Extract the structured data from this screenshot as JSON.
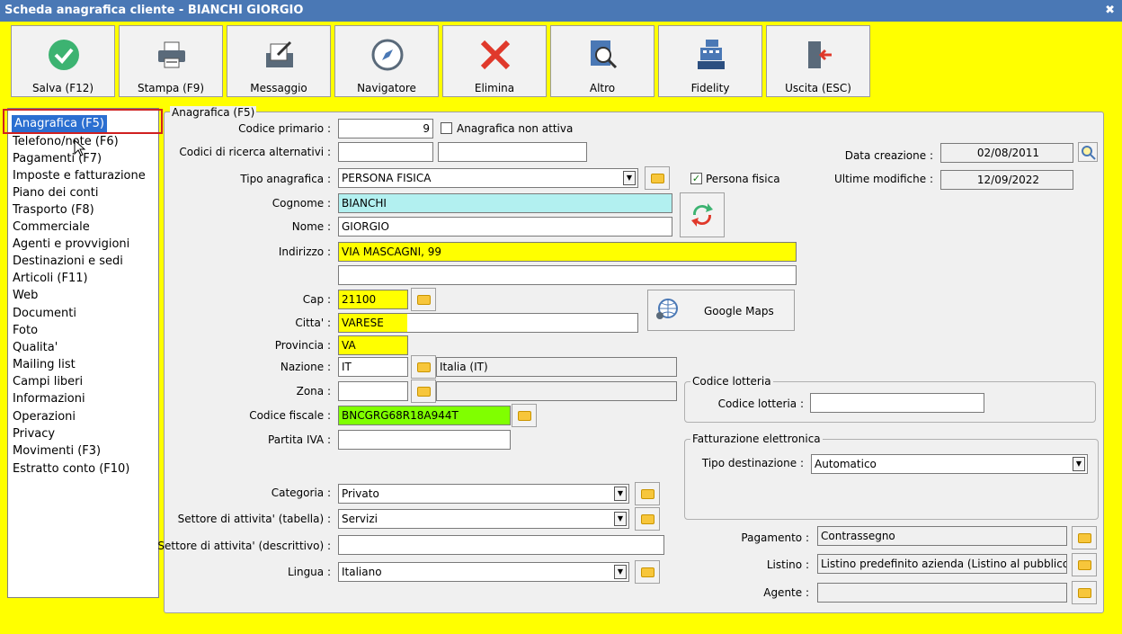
{
  "window": {
    "title": "Scheda anagrafica cliente - BIANCHI GIORGIO",
    "close_glyph": "✖"
  },
  "toolbar": [
    {
      "label": "Salva (F12)",
      "icon": "check-circle-icon"
    },
    {
      "label": "Stampa (F9)",
      "icon": "printer-icon"
    },
    {
      "label": "Messaggio",
      "icon": "message-icon"
    },
    {
      "label": "Navigatore",
      "icon": "compass-icon"
    },
    {
      "label": "Elimina",
      "icon": "delete-x-icon"
    },
    {
      "label": "Altro",
      "icon": "search-document-icon"
    },
    {
      "label": "Fidelity",
      "icon": "cash-register-icon"
    },
    {
      "label": "Uscita (ESC)",
      "icon": "exit-door-icon"
    }
  ],
  "sidebar": {
    "items": [
      {
        "label": "Anagrafica (F5)"
      },
      {
        "label": "Telefono/note (F6)"
      },
      {
        "label": "Pagamenti (F7)"
      },
      {
        "label": "Imposte e fatturazione"
      },
      {
        "label": "Piano dei conti"
      },
      {
        "label": "Trasporto (F8)"
      },
      {
        "label": "Commerciale"
      },
      {
        "label": "Agenti e provvigioni"
      },
      {
        "label": "Destinazioni e sedi"
      },
      {
        "label": "Articoli (F11)"
      },
      {
        "label": "Web"
      },
      {
        "label": "Documenti"
      },
      {
        "label": "Foto"
      },
      {
        "label": "Qualita'"
      },
      {
        "label": "Mailing list"
      },
      {
        "label": "Campi liberi"
      },
      {
        "label": "Informazioni"
      },
      {
        "label": "Operazioni"
      },
      {
        "label": "Privacy"
      },
      {
        "label": "Movimenti (F3)"
      },
      {
        "label": "Estratto conto (F10)"
      }
    ]
  },
  "form": {
    "group_title": "Anagrafica (F5)",
    "codice_primario": {
      "label": "Codice primario :",
      "value": "9"
    },
    "non_attiva": {
      "label": "Anagrafica non attiva",
      "checked": false
    },
    "codici_ricerca": {
      "label": "Codici di ricerca alternativi :",
      "value1": "",
      "value2": ""
    },
    "data_creazione": {
      "label": "Data creazione :",
      "value": "02/08/2011"
    },
    "ultime_modifiche": {
      "label": "Ultime modifiche :",
      "value": "12/09/2022"
    },
    "tipo_anagrafica": {
      "label": "Tipo anagrafica :",
      "value": "PERSONA FISICA"
    },
    "persona_fisica": {
      "label": "Persona fisica",
      "checked": true,
      "mark": "✓"
    },
    "cognome": {
      "label": "Cognome :",
      "value": "BIANCHI"
    },
    "nome": {
      "label": "Nome :",
      "value": "GIORGIO"
    },
    "indirizzo": {
      "label": "Indirizzo :",
      "value": "VIA MASCAGNI, 99",
      "value2": ""
    },
    "cap": {
      "label": "Cap :",
      "value": "21100"
    },
    "citta": {
      "label": "Citta' :",
      "value": "VARESE"
    },
    "provincia": {
      "label": "Provincia :",
      "value": "VA"
    },
    "nazione": {
      "label": "Nazione :",
      "value": "IT",
      "description": "Italia (IT)"
    },
    "zona": {
      "label": "Zona :",
      "value": "",
      "description": ""
    },
    "codice_fiscale": {
      "label": "Codice fiscale :",
      "value": "BNCGRG68R18A944T"
    },
    "partita_iva": {
      "label": "Partita IVA :",
      "value": ""
    },
    "google_maps": {
      "label": "Google Maps"
    },
    "lotteria": {
      "group_title": "Codice lotteria",
      "label": "Codice lotteria :",
      "value": ""
    },
    "fattura": {
      "group_title": "Fatturazione elettronica",
      "label": "Tipo destinazione :",
      "value": "Automatico"
    },
    "categoria": {
      "label": "Categoria :",
      "value": "Privato"
    },
    "settore_tabella": {
      "label": "Settore di attivita' (tabella) :",
      "value": "Servizi"
    },
    "settore_descr": {
      "label": "Settore di attivita' (descrittivo) :",
      "value": ""
    },
    "lingua": {
      "label": "Lingua :",
      "value": "Italiano"
    },
    "pagamento": {
      "label": "Pagamento :",
      "value": "Contrassegno"
    },
    "listino": {
      "label": "Listino :",
      "value": "Listino predefinito azienda (Listino al pubblico)"
    },
    "agente": {
      "label": "Agente :",
      "value": ""
    },
    "dropdown_glyph": "▼"
  }
}
